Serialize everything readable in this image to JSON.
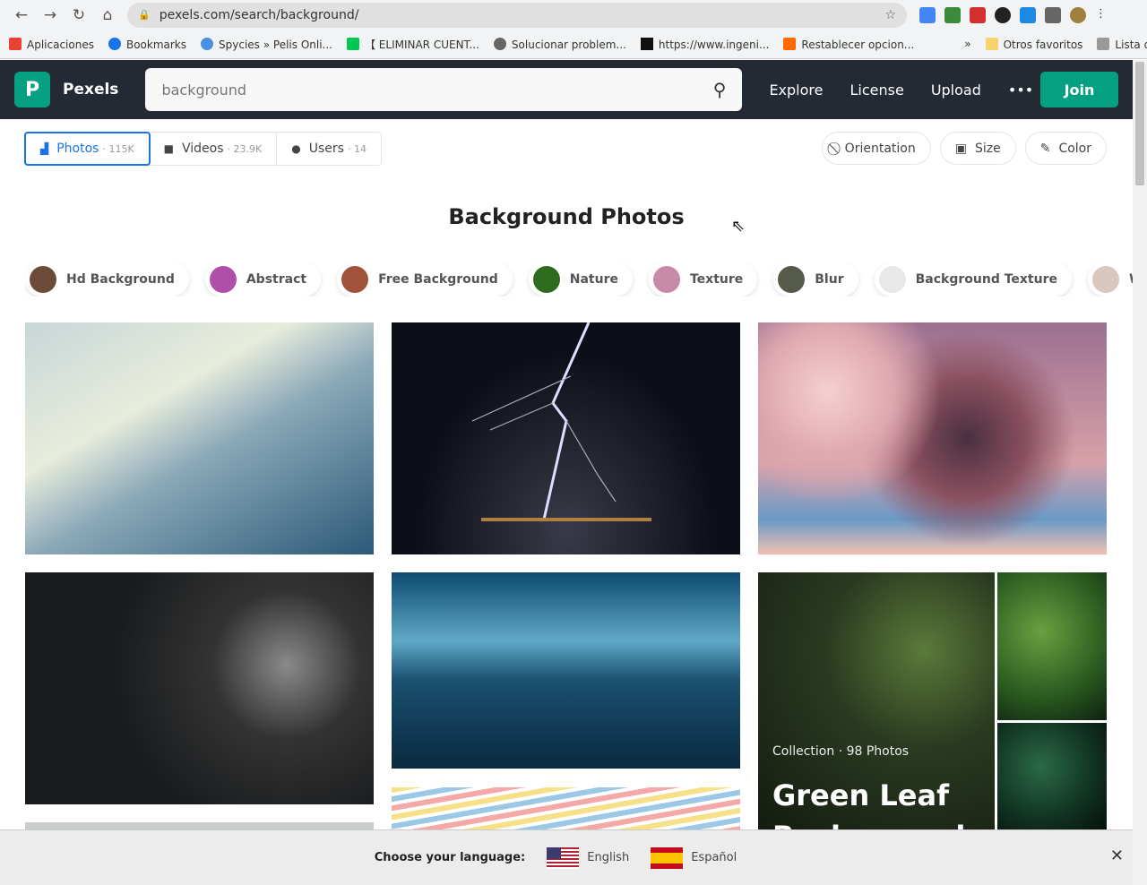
{
  "browser": {
    "url": "pexels.com/search/background/",
    "bookmarks": [
      {
        "label": "Aplicaciones",
        "color": "#e94235"
      },
      {
        "label": "Bookmarks",
        "color": "#1a73e8"
      },
      {
        "label": "Spycies » Pelis Onli...",
        "color": "#4a90e2"
      },
      {
        "label": "【 ELIMINAR CUENT...",
        "color": "#00c853"
      },
      {
        "label": "Solucionar problem...",
        "color": "#666666"
      },
      {
        "label": "https://www.ingeni...",
        "color": "#111111"
      },
      {
        "label": "Restablecer opcion...",
        "color": "#ff6900"
      }
    ],
    "more": "»",
    "other_favorites": "Otros favoritos",
    "reading_list": "Lista de lectura"
  },
  "header": {
    "brand": "Pexels",
    "logo": "P",
    "search_value": "background",
    "nav": [
      "Explore",
      "License",
      "Upload",
      "•••"
    ],
    "join": "Join"
  },
  "tabs": [
    {
      "label": "Photos",
      "count": "· 115K",
      "icon": "image-icon"
    },
    {
      "label": "Videos",
      "count": "· 23.9K",
      "icon": "video-icon"
    },
    {
      "label": "Users",
      "count": "· 14",
      "icon": "user-icon"
    }
  ],
  "filters": [
    {
      "label": "Orientation",
      "icon": "⃠"
    },
    {
      "label": "Size",
      "icon": "▣"
    },
    {
      "label": "Color",
      "icon": "✎"
    }
  ],
  "page_title": "Background Photos",
  "chips": [
    {
      "label": "Hd Background",
      "color": "#6b4a3a"
    },
    {
      "label": "Abstract",
      "color": "#b04fa8"
    },
    {
      "label": "Free Background",
      "color": "#a0523a"
    },
    {
      "label": "Nature",
      "color": "#2f6b1f"
    },
    {
      "label": "Texture",
      "color": "#c98aa8"
    },
    {
      "label": "Blur",
      "color": "#555a4a"
    },
    {
      "label": "Background Texture",
      "color": "#e8e8e8"
    },
    {
      "label": "Wall",
      "color": "#d9c8c0"
    },
    {
      "label": "",
      "color": "#a07050"
    }
  ],
  "collection": {
    "meta": "Collection · 98 Photos",
    "title": "Green Leaf Background"
  },
  "language_bar": {
    "prompt": "Choose your language:",
    "options": [
      "English",
      "Español"
    ],
    "close": "✕"
  }
}
